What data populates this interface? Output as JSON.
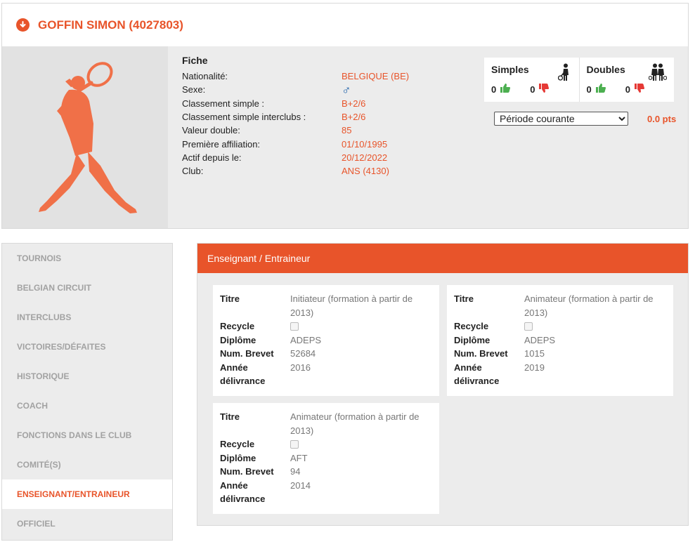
{
  "player": {
    "name": "GOFFIN SIMON (4027803)"
  },
  "fiche": {
    "title": "Fiche",
    "rows": [
      {
        "label": "Nationalité:",
        "value": "BELGIQUE (BE)"
      },
      {
        "label": "Sexe:",
        "value": "♂"
      },
      {
        "label": "Classement simple :",
        "value": "B+2/6"
      },
      {
        "label": "Classement simple interclubs :",
        "value": "B+2/6"
      },
      {
        "label": "Valeur double:",
        "value": "85"
      },
      {
        "label": "Première affiliation:",
        "value": "01/10/1995"
      },
      {
        "label": "Actif depuis le:",
        "value": "20/12/2022"
      },
      {
        "label": "Club:",
        "value": "ANS (4130)"
      }
    ]
  },
  "stats": {
    "simples": {
      "label": "Simples",
      "wins": "0",
      "losses": "0"
    },
    "doubles": {
      "label": "Doubles",
      "wins": "0",
      "losses": "0"
    }
  },
  "period": {
    "selected": "Période courante",
    "points": "0.0 pts"
  },
  "sidebar": {
    "items": [
      {
        "label": "TOURNOIS",
        "active": false
      },
      {
        "label": "BELGIAN CIRCUIT",
        "active": false
      },
      {
        "label": "INTERCLUBS",
        "active": false
      },
      {
        "label": "VICTOIRES/DÉFAITES",
        "active": false
      },
      {
        "label": "HISTORIQUE",
        "active": false
      },
      {
        "label": "COACH",
        "active": false
      },
      {
        "label": "FONCTIONS DANS LE CLUB",
        "active": false
      },
      {
        "label": "COMITÉ(S)",
        "active": false
      },
      {
        "label": "ENSEIGNANT/ENTRAINEUR",
        "active": true
      },
      {
        "label": "OFFICIEL",
        "active": false
      }
    ]
  },
  "panel": {
    "title": "Enseignant / Entraineur",
    "labels": {
      "titre": "Titre",
      "recycle": "Recycle",
      "diplome": "Diplôme",
      "brevet": "Num. Brevet",
      "annee": "Année délivrance"
    },
    "certificates": [
      {
        "titre": "Initiateur (formation à partir de 2013)",
        "diplome": "ADEPS",
        "brevet": "52684",
        "annee": "2016",
        "recycle": false
      },
      {
        "titre": "Animateur (formation à partir de 2013)",
        "diplome": "ADEPS",
        "brevet": "1015",
        "annee": "2019",
        "recycle": false
      },
      {
        "titre": "Animateur (formation à partir de 2013)",
        "diplome": "AFT",
        "brevet": "94",
        "annee": "2014",
        "recycle": false
      }
    ]
  },
  "colors": {
    "accent": "#e8542a",
    "male": "#1b5fa8",
    "win": "#4caf50",
    "loss": "#e53935"
  }
}
